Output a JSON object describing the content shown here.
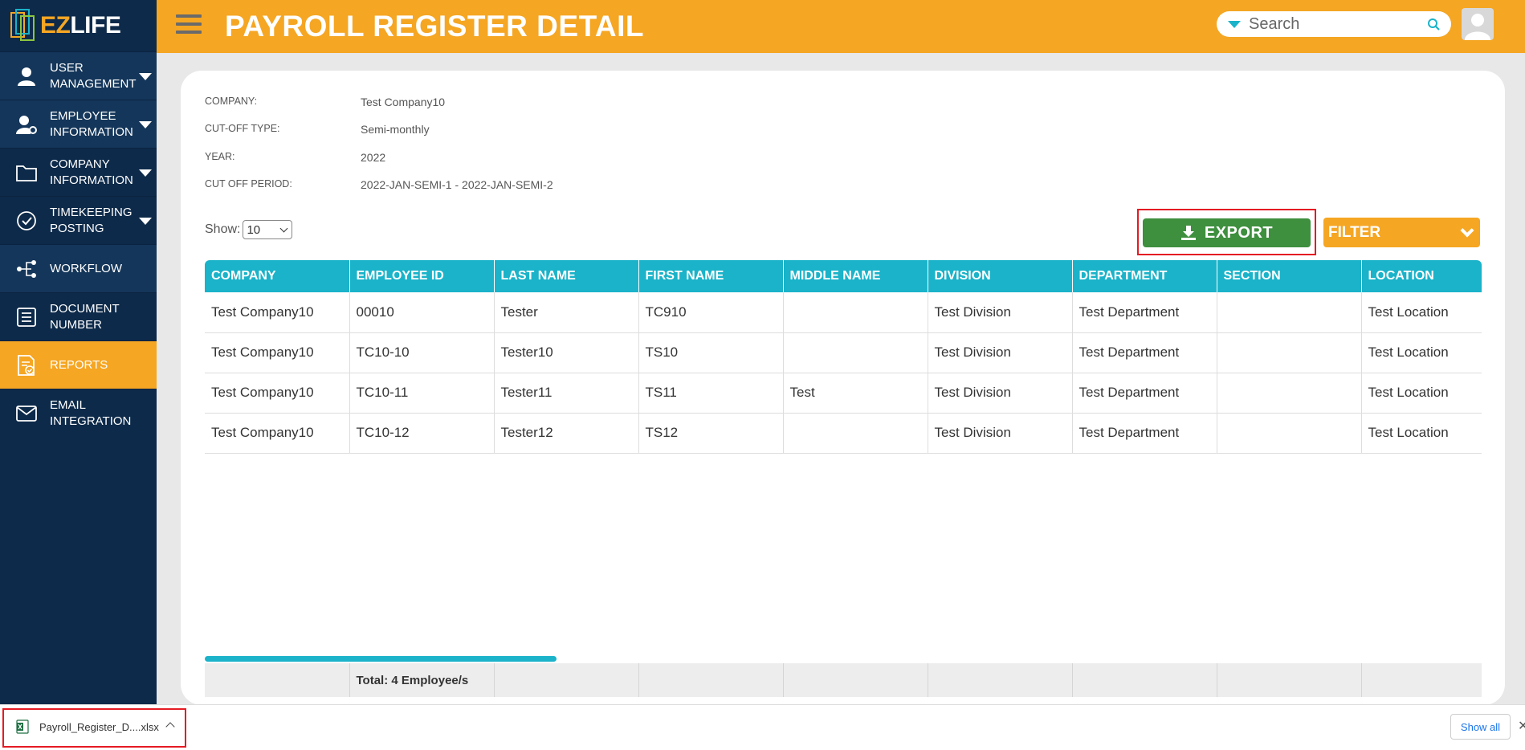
{
  "app": {
    "logo_ez": "EZ",
    "logo_life": "LIFE",
    "page_title": "PAYROLL REGISTER DETAIL"
  },
  "search": {
    "placeholder": "Search"
  },
  "sidebar": {
    "items": [
      {
        "label": "USER MANAGEMENT",
        "icon": "user-icon",
        "has_caret": true
      },
      {
        "label": "EMPLOYEE INFORMATION",
        "icon": "employee-settings-icon",
        "has_caret": true
      },
      {
        "label": "COMPANY INFORMATION",
        "icon": "folder-icon",
        "has_caret": true
      },
      {
        "label": "TIMEKEEPING POSTING",
        "icon": "check-circle-icon",
        "has_caret": true
      },
      {
        "label": "WORKFLOW",
        "icon": "workflow-icon",
        "has_caret": false
      },
      {
        "label": "DOCUMENT NUMBER",
        "icon": "list-icon",
        "has_caret": false
      },
      {
        "label": "REPORTS",
        "icon": "report-icon",
        "has_caret": false,
        "active": true
      },
      {
        "label": "EMAIL INTEGRATION",
        "icon": "mail-icon",
        "has_caret": false
      }
    ]
  },
  "info": {
    "company_label": "COMPANY:",
    "company_value": "Test Company10",
    "cutoff_type_label": "CUT-OFF TYPE:",
    "cutoff_type_value": "Semi-monthly",
    "year_label": "YEAR:",
    "year_value": "2022",
    "cutoff_period_label": "CUT OFF PERIOD:",
    "cutoff_period_value": "2022-JAN-SEMI-1 - 2022-JAN-SEMI-2"
  },
  "controls": {
    "show_label": "Show:",
    "show_value": "10",
    "export_label": "EXPORT",
    "filter_label": "FILTER"
  },
  "table": {
    "columns": [
      "COMPANY",
      "EMPLOYEE ID",
      "LAST NAME",
      "FIRST NAME",
      "MIDDLE NAME",
      "DIVISION",
      "DEPARTMENT",
      "SECTION",
      "LOCATION"
    ],
    "rows": [
      [
        "Test Company10",
        "00010",
        "Tester",
        "TC910",
        "",
        "Test Division",
        "Test Department",
        "",
        "Test Location"
      ],
      [
        "Test Company10",
        "TC10-10",
        "Tester10",
        "TS10",
        "",
        "Test Division",
        "Test Department",
        "",
        "Test Location"
      ],
      [
        "Test Company10",
        "TC10-11",
        "Tester11",
        "TS11",
        "Test",
        "Test Division",
        "Test Department",
        "",
        "Test Location"
      ],
      [
        "Test Company10",
        "TC10-12",
        "Tester12",
        "TS12",
        "",
        "Test Division",
        "Test Department",
        "",
        "Test Location"
      ]
    ],
    "footer_total": "Total: 4 Employee/s"
  },
  "download_bar": {
    "filename": "Payroll_Register_D....xlsx",
    "show_all": "Show all",
    "close": "✕"
  },
  "colors": {
    "accent_orange": "#f5a623",
    "sidebar_navy": "#0d2a4a",
    "table_header_teal": "#1ab3c9",
    "export_green": "#3e8f3e",
    "highlight_red": "#e41b23"
  }
}
